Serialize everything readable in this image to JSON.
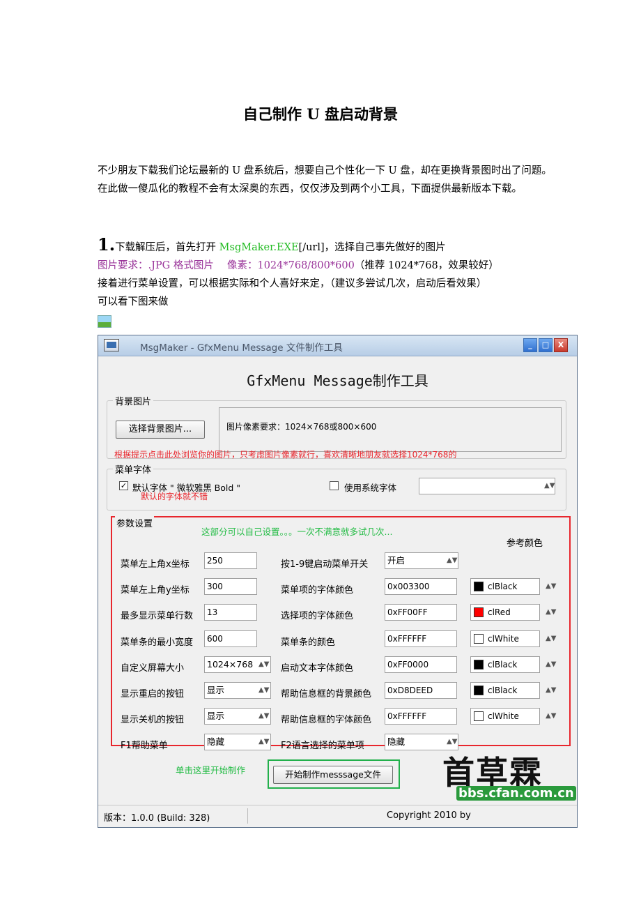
{
  "doc": {
    "title": "自己制作 U 盘启动背景",
    "intro": "不少朋友下载我们论坛最新的 U 盘系统后，想要自己个性化一下 U 盘，却在更换背景图时出了问题。在此做一傻瓜化的教程不会有太深奥的东西，仅仅涉及到两个小工具，下面提供最新版本下载。",
    "step_num": "1.",
    "step_a": "下载解压后，首先打开 ",
    "step_link": "MsgMaker.EXE",
    "step_b": "[/url]，选择自己事先做好的图片",
    "req_line_a": "图片要求：.JPG 格式图片　 像素：1024*768/800*600",
    "req_line_b": "（推荐 1024*768，效果较好）",
    "line2": "接着进行菜单设置，可以根据实际和个人喜好来定，（建议多尝试几次，启动后看效果）",
    "line3": "可以看下图来做"
  },
  "window": {
    "title": "MsgMaker - GfxMenu Message 文件制作工具",
    "btn_min": "_",
    "btn_max": "□",
    "btn_close": "X",
    "heading": "GfxMenu Message制作工具",
    "bg_group": "背景图片",
    "bg_button": "选择背景图片...",
    "bg_req": "图片像素要求：1024×768或800×600",
    "bg_note": "根据提示点击此处浏览你的图片，只考虑图片像素就行，喜欢清晰地朋友就选择1024*768的",
    "font_group": "菜单字体",
    "font_default": "默认字体 \" 微软雅黑 Bold \"",
    "font_default_checked": "✓",
    "font_note": "默认的字体就不错",
    "font_system": "使用系统字体",
    "font_select": "",
    "param_group": "参数设置",
    "param_note": "这部分可以自己设置。。。一次不满意就多试几次...",
    "ref_color_header": "参考颜色",
    "left_params": [
      {
        "label": "菜单左上角x坐标",
        "value": "250"
      },
      {
        "label": "菜单左上角y坐标",
        "value": "300"
      },
      {
        "label": "最多显示菜单行数",
        "value": "13"
      },
      {
        "label": "菜单条的最小宽度",
        "value": "600"
      },
      {
        "label": "自定义屏幕大小",
        "value": "1024×768"
      },
      {
        "label": "显示重启的按钮",
        "value": "显示"
      },
      {
        "label": "显示关机的按钮",
        "value": "显示"
      },
      {
        "label": "F1帮助菜单",
        "value": "隐藏"
      }
    ],
    "right_params": [
      {
        "label": "按1-9键启动菜单开关",
        "value": "开启"
      },
      {
        "label": "菜单项的字体颜色",
        "value": "0x003300"
      },
      {
        "label": "选择项的字体颜色",
        "value": "0xFF00FF"
      },
      {
        "label": "菜单条的颜色",
        "value": "0xFFFFFF"
      },
      {
        "label": "启动文本字体颜色",
        "value": "0xFF0000"
      },
      {
        "label": "帮助信息框的背景颜色",
        "value": "0xD8DEED"
      },
      {
        "label": "帮助信息框的字体颜色",
        "value": "0xFFFFFF"
      },
      {
        "label": "F2语言选择的菜单项",
        "value": "隐藏"
      }
    ],
    "ref_colors": [
      {
        "name": "clBlack",
        "color": "#000000"
      },
      {
        "name": "clRed",
        "color": "#ff0000"
      },
      {
        "name": "clWhite",
        "color": "#ffffff"
      },
      {
        "name": "clBlack",
        "color": "#000000"
      },
      {
        "name": "clBlack",
        "color": "#000000"
      },
      {
        "name": "clWhite",
        "color": "#ffffff"
      }
    ],
    "start_note": "单击这里开始制作",
    "start_button": "开始制作messsage文件",
    "logo_text": "首草霖",
    "logo_url": "bbs.cfan.com.cn",
    "status_left": "版本：1.0.0 (Build: 328)",
    "status_right": "Copyright 2010 by"
  },
  "colors": {
    "accent_red": "#e8262d",
    "accent_green": "#22b04b",
    "link_green": "#22bb22",
    "req_purple": "#993399"
  }
}
